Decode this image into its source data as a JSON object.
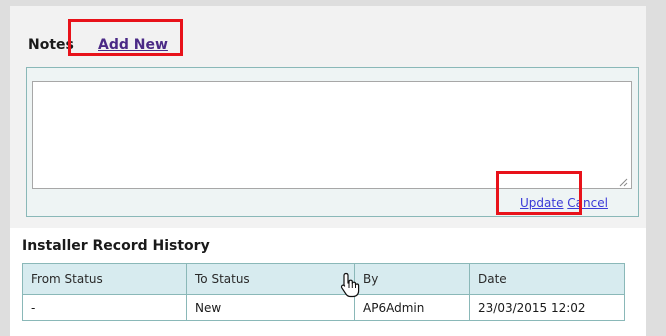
{
  "notes": {
    "title": "Notes",
    "add_new_label": "Add New",
    "textarea_value": "",
    "update_label": "Update",
    "cancel_label": "Cancel"
  },
  "history": {
    "title": "Installer Record History",
    "columns": [
      "From Status",
      "To Status",
      "By",
      "Date"
    ],
    "rows": [
      [
        "-",
        "New",
        "AP6Admin",
        "23/03/2015 12:02"
      ]
    ]
  },
  "colors": {
    "highlight": "#e8121a",
    "link": "#3a3ad8",
    "add_new_link": "#4b2a86",
    "table_header_bg": "#d7ebef",
    "border": "#8ab8b8"
  },
  "icons": [
    "resize-grip-icon",
    "hand-pointer-icon"
  ]
}
